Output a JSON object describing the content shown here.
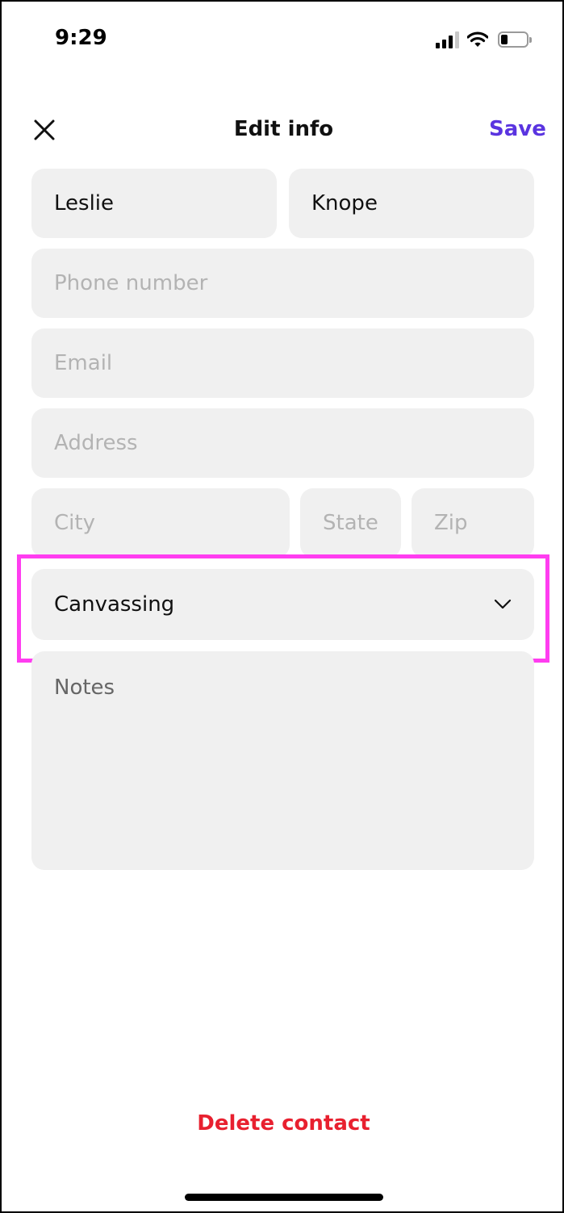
{
  "status_bar": {
    "time": "9:29",
    "battery_level": 0.25
  },
  "header": {
    "title": "Edit info",
    "save_label": "Save",
    "close_icon": "close-icon",
    "accent_color": "#5a34e0"
  },
  "form": {
    "first_name": {
      "value": "Leslie"
    },
    "last_name": {
      "value": "Knope"
    },
    "phone": {
      "placeholder": "Phone number"
    },
    "email": {
      "placeholder": "Email"
    },
    "address": {
      "placeholder": "Address"
    },
    "city": {
      "placeholder": "City"
    },
    "state": {
      "placeholder": "State"
    },
    "zip": {
      "placeholder": "Zip"
    },
    "category": {
      "selected": "Canvassing",
      "icon": "chevron-down-icon"
    },
    "notes": {
      "placeholder": "Notes"
    }
  },
  "footer": {
    "delete_label": "Delete contact",
    "delete_color": "#e8202f"
  },
  "highlight_color": "#ff3df0"
}
